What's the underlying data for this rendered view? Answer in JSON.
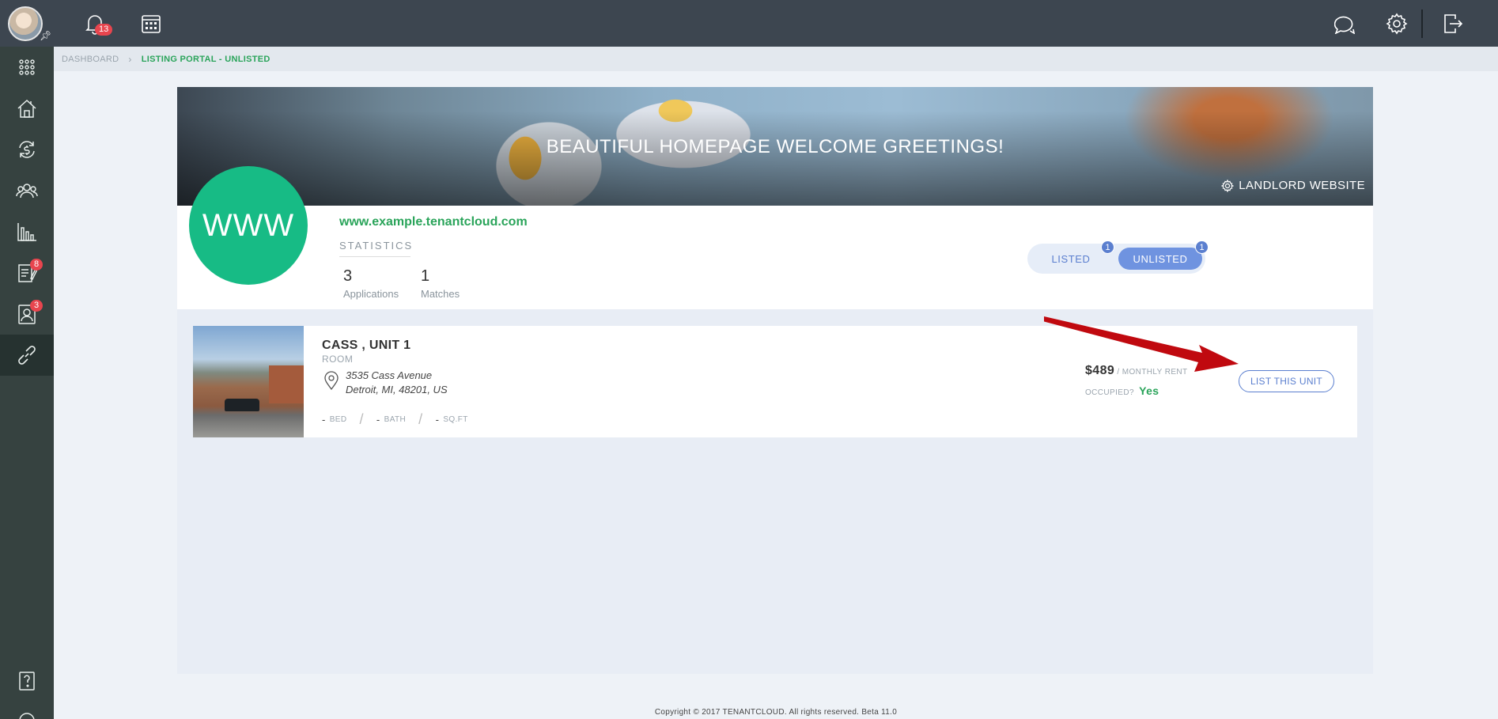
{
  "topbar": {
    "notifications_count": "13",
    "icons": [
      "bell-icon",
      "calendar-icon",
      "chat-icon",
      "settings-icon",
      "logout-icon"
    ]
  },
  "sidebar": {
    "items": [
      {
        "name": "apps-grid-icon"
      },
      {
        "name": "properties-icon"
      },
      {
        "name": "accounting-icon"
      },
      {
        "name": "contacts-icon"
      },
      {
        "name": "reports-icon"
      },
      {
        "name": "documents-icon",
        "badge": "8"
      },
      {
        "name": "applications-icon",
        "badge": "3"
      },
      {
        "name": "listing-link-icon",
        "active": true
      }
    ],
    "bottom": [
      "help-icon",
      "support-headset-icon"
    ]
  },
  "breadcrumb": {
    "root": "DASHBOARD",
    "current": "LISTING PORTAL - UNLISTED"
  },
  "hero": {
    "greeting": "BEAUTIFUL HOMEPAGE WELCOME GREETINGS!",
    "landlord_link": "LANDLORD WEBSITE"
  },
  "profile": {
    "avatar_text": "WWW",
    "site_url": "www.example.tenantcloud.com",
    "statistics_label": "STATISTICS",
    "stats": [
      {
        "value": "3",
        "label": "Applications"
      },
      {
        "value": "1",
        "label": "Matches"
      }
    ]
  },
  "toggle": {
    "listed_label": "LISTED",
    "listed_count": "1",
    "unlisted_label": "UNLISTED",
    "unlisted_count": "1",
    "selected": "UNLISTED"
  },
  "unit": {
    "title": "CASS , UNIT 1",
    "type": "ROOM",
    "address_line1": "3535 Cass Avenue",
    "address_line2": "Detroit, MI, 48201, US",
    "bed_value": "-",
    "bed_label": "BED",
    "bath_value": "-",
    "bath_label": "BATH",
    "sqft_value": "-",
    "sqft_label": "SQ.FT",
    "rent_amount": "$489",
    "rent_label": "/ MONTHLY RENT",
    "occupied_label": "OCCUPIED?",
    "occupied_value": "Yes",
    "list_button": "LIST THIS UNIT"
  },
  "annotation": {
    "arrow_color": "#c0090f"
  },
  "colors": {
    "accent_green": "#2aa45a",
    "www_circle": "#17bb85",
    "primary_blue": "#5b7fcf",
    "topbar": "#3d4650",
    "sidebar": "#364240"
  },
  "footer": {
    "copyright": "Copyright © 2017 TENANTCLOUD. All rights reserved. Beta 11.0"
  }
}
